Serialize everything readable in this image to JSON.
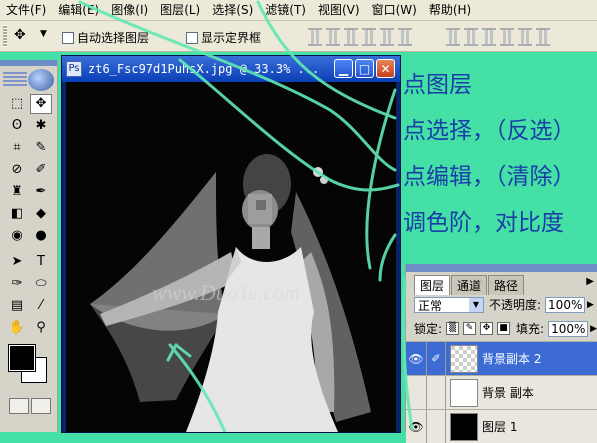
{
  "menu": [
    {
      "label": "文件",
      "key": "(F)"
    },
    {
      "label": "编辑",
      "key": "(E)"
    },
    {
      "label": "图像",
      "key": "(I)"
    },
    {
      "label": "图层",
      "key": "(L)"
    },
    {
      "label": "选择",
      "key": "(S)"
    },
    {
      "label": "滤镜",
      "key": "(T)"
    },
    {
      "label": "视图",
      "key": "(V)"
    },
    {
      "label": "窗口",
      "key": "(W)"
    },
    {
      "label": "帮助",
      "key": "(H)"
    }
  ],
  "options": {
    "auto_select_layer": "自动选择图层",
    "show_bounding_box": "显示定界框"
  },
  "document": {
    "title": "zt6_Fsc97d1PuhsX.jpg @ 33.3% ...",
    "watermark": "www.DuoTe.com"
  },
  "tutorial": {
    "line1": "点图层",
    "line2": "点选择，（反选）",
    "line3": "点编辑，（清除）",
    "line4": "调色阶，对比度"
  },
  "layers_panel": {
    "tabs": [
      "图层",
      "通道",
      "路径"
    ],
    "blend_mode": "正常",
    "opacity_label": "不透明度:",
    "opacity_value": "100%",
    "lock_label": "锁定:",
    "fill_label": "填充:",
    "fill_value": "100%",
    "layers": [
      {
        "name": "背景副本 2",
        "visible": true,
        "selected": true
      },
      {
        "name": "背景 副本",
        "visible": false,
        "selected": false
      },
      {
        "name": "图层 1",
        "visible": true,
        "selected": false
      }
    ]
  },
  "colors": {
    "background_green": "#44e0a6",
    "annotation_stroke": "#5fe8b4",
    "tutorial_text": "#1a3ea8",
    "selected_layer": "#3b6bd3"
  }
}
